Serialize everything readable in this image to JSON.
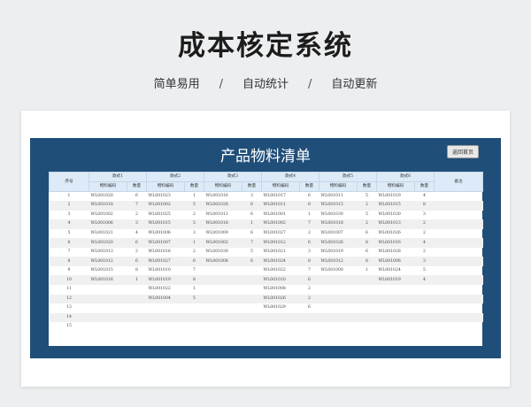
{
  "header": {
    "title": "成本核定系统",
    "taglines": [
      "简单易用",
      "自动统计",
      "自动更新"
    ],
    "separator": "/"
  },
  "panel": {
    "title": "产品物料清单",
    "back_button": "返回首页"
  },
  "table": {
    "col_index": "序号",
    "col_remark": "备注",
    "styles": [
      "款式1",
      "款式2",
      "款式3",
      "款式4",
      "款式5",
      "款式6"
    ],
    "sub_code": "物料编码",
    "sub_qty": "数量",
    "rows": [
      {
        "n": "1",
        "c": [
          [
            "WL001020",
            "6"
          ],
          [
            "WL001023",
            "1"
          ],
          [
            "WL001016",
            "3"
          ],
          [
            "WL001017",
            "6"
          ],
          [
            "WL001011",
            "5"
          ],
          [
            "WL001019",
            "4"
          ]
        ]
      },
      {
        "n": "2",
        "c": [
          [
            "WL001018",
            "7"
          ],
          [
            "WL001002",
            "5"
          ],
          [
            "WL001028",
            "6"
          ],
          [
            "WL001011",
            "8"
          ],
          [
            "WL001015",
            "2"
          ],
          [
            "WL001015",
            "8"
          ]
        ]
      },
      {
        "n": "3",
        "c": [
          [
            "WL001002",
            "2"
          ],
          [
            "WL001025",
            "2"
          ],
          [
            "WL001011",
            "6"
          ],
          [
            "WL001001",
            "1"
          ],
          [
            "WL001030",
            "5"
          ],
          [
            "WL001030",
            "3"
          ]
        ]
      },
      {
        "n": "4",
        "c": [
          [
            "WL001006",
            "3"
          ],
          [
            "WL001015",
            "5"
          ],
          [
            "WL001018",
            "1"
          ],
          [
            "WL001002",
            "7"
          ],
          [
            "WL001018",
            "2"
          ],
          [
            "WL001013",
            "2"
          ]
        ]
      },
      {
        "n": "5",
        "c": [
          [
            "WL001021",
            "4"
          ],
          [
            "WL001006",
            "3"
          ],
          [
            "WL001009",
            "6"
          ],
          [
            "WL001027",
            "2"
          ],
          [
            "WL001007",
            "6"
          ],
          [
            "WL001026",
            "2"
          ]
        ]
      },
      {
        "n": "6",
        "c": [
          [
            "WL001020",
            "6"
          ],
          [
            "WL001007",
            "1"
          ],
          [
            "WL001002",
            "7"
          ],
          [
            "WL001012",
            "6"
          ],
          [
            "WL001026",
            "8"
          ],
          [
            "WL001016",
            "4"
          ]
        ]
      },
      {
        "n": "7",
        "c": [
          [
            "WL001013",
            "2"
          ],
          [
            "WL001016",
            "2"
          ],
          [
            "WL001030",
            "5"
          ],
          [
            "WL001021",
            "3"
          ],
          [
            "WL001019",
            "6"
          ],
          [
            "WL001028",
            "2"
          ]
        ]
      },
      {
        "n": "8",
        "c": [
          [
            "WL001012",
            "6"
          ],
          [
            "WL001027",
            "6"
          ],
          [
            "WL001008",
            "6"
          ],
          [
            "WL001024",
            "8"
          ],
          [
            "WL001012",
            "8"
          ],
          [
            "WL001006",
            "3"
          ]
        ]
      },
      {
        "n": "9",
        "c": [
          [
            "WL001015",
            "8"
          ],
          [
            "WL001010",
            "7"
          ],
          [
            "",
            ""
          ],
          [
            "WL001022",
            "7"
          ],
          [
            "WL001000",
            "1"
          ],
          [
            "WL001024",
            "5"
          ]
        ]
      },
      {
        "n": "10",
        "c": [
          [
            "WL001016",
            "1"
          ],
          [
            "WL001019",
            "8"
          ],
          [
            "",
            ""
          ],
          [
            "WL001010",
            "6"
          ],
          [
            "",
            ""
          ],
          [
            "WL001019",
            "4"
          ]
        ]
      },
      {
        "n": "11",
        "c": [
          [
            "",
            ""
          ],
          [
            "WL001022",
            "1"
          ],
          [
            "",
            ""
          ],
          [
            "WL001008",
            "2"
          ],
          [
            "",
            ""
          ],
          [
            "",
            ""
          ]
        ]
      },
      {
        "n": "12",
        "c": [
          [
            "",
            ""
          ],
          [
            "WL001004",
            "5"
          ],
          [
            "",
            ""
          ],
          [
            "WL001026",
            "2"
          ],
          [
            "",
            ""
          ],
          [
            "",
            ""
          ]
        ]
      },
      {
        "n": "13",
        "c": [
          [
            "",
            ""
          ],
          [
            "",
            ""
          ],
          [
            "",
            ""
          ],
          [
            "WL001029",
            "6"
          ],
          [
            "",
            ""
          ],
          [
            "",
            ""
          ]
        ]
      },
      {
        "n": "14",
        "c": [
          [
            "",
            ""
          ],
          [
            "",
            ""
          ],
          [
            "",
            ""
          ],
          [
            "",
            ""
          ],
          [
            "",
            ""
          ],
          [
            "",
            ""
          ]
        ]
      },
      {
        "n": "15",
        "c": [
          [
            "",
            ""
          ],
          [
            "",
            ""
          ],
          [
            "",
            ""
          ],
          [
            "",
            ""
          ],
          [
            "",
            ""
          ],
          [
            "",
            ""
          ]
        ]
      }
    ]
  }
}
